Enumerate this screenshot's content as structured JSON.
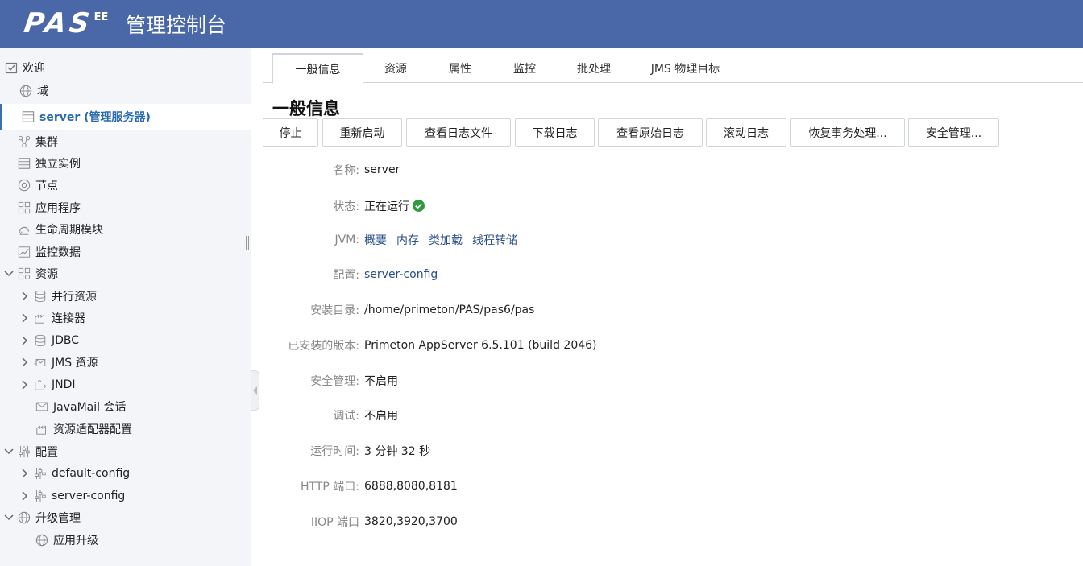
{
  "header": {
    "logo_text": "PAS",
    "logo_superscript": "EE",
    "title": "管理控制台",
    "bg_color": "#4a68a7"
  },
  "sidebar": {
    "items": [
      {
        "label": "欢迎",
        "icon": "welcome-check-icon"
      },
      {
        "label": "域",
        "icon": "globe-icon"
      },
      {
        "label": "server (管理服务器)",
        "icon": "server-icon",
        "selected": true
      },
      {
        "label": "集群",
        "icon": "cluster-icon"
      },
      {
        "label": "独立实例",
        "icon": "instance-icon"
      },
      {
        "label": "节点",
        "icon": "node-icon"
      },
      {
        "label": "应用程序",
        "icon": "apps-grid-icon"
      },
      {
        "label": "生命周期模块",
        "icon": "lifecycle-icon"
      },
      {
        "label": "监控数据",
        "icon": "chart-icon"
      },
      {
        "label": "资源",
        "icon": "resources-icon",
        "expanded": true
      },
      {
        "label": "并行资源",
        "icon": "database-icon"
      },
      {
        "label": "连接器",
        "icon": "connector-icon"
      },
      {
        "label": "JDBC",
        "icon": "database-icon"
      },
      {
        "label": "JMS 资源",
        "icon": "jms-icon"
      },
      {
        "label": "JNDI",
        "icon": "puzzle-icon"
      },
      {
        "label": "JavaMail 会话",
        "icon": "mail-icon"
      },
      {
        "label": "资源适配器配置",
        "icon": "connector-icon"
      },
      {
        "label": "配置",
        "icon": "sliders-icon",
        "expanded": true
      },
      {
        "label": "default-config",
        "icon": "sliders-icon"
      },
      {
        "label": "server-config",
        "icon": "sliders-icon"
      },
      {
        "label": "升级管理",
        "icon": "globe-icon",
        "expanded": true
      },
      {
        "label": "应用升级",
        "icon": "globe-icon"
      }
    ]
  },
  "tabs": [
    {
      "label": "一般信息",
      "active": true
    },
    {
      "label": "资源"
    },
    {
      "label": "属性"
    },
    {
      "label": "监控"
    },
    {
      "label": "批处理"
    },
    {
      "label": "JMS 物理目标"
    }
  ],
  "page_title": "一般信息",
  "buttons": [
    "停止",
    "重新启动",
    "查看日志文件",
    "下载日志",
    "查看原始日志",
    "滚动日志",
    "恢复事务处理...",
    "安全管理..."
  ],
  "info": {
    "name_label": "名称:",
    "name_value": "server",
    "status_label": "状态:",
    "status_value": "正在运行",
    "jvm_label": "JVM:",
    "jvm_links": [
      "概要",
      "内存",
      "类加载",
      "线程转储"
    ],
    "config_label": "配置:",
    "config_value": "server-config",
    "install_label": "安装目录:",
    "install_value": "/home/primeton/PAS/pas6/pas",
    "version_label": "已安装的版本:",
    "version_value": "Primeton AppServer 6.5.101 (build 2046)",
    "security_label": "安全管理:",
    "security_value": "不启用",
    "debug_label": "调试:",
    "debug_value": "不启用",
    "uptime_label": "运行时间:",
    "uptime_value": "3 分钟 32 秒",
    "http_label": "HTTP 端口:",
    "http_value": "6888,8080,8181",
    "iiop_label": "IIOP 端口",
    "iiop_value": "3820,3920,3700"
  },
  "colors": {
    "accent": "#2a6ab3",
    "link": "#2a4f8a",
    "ok": "#2e9b3d"
  }
}
